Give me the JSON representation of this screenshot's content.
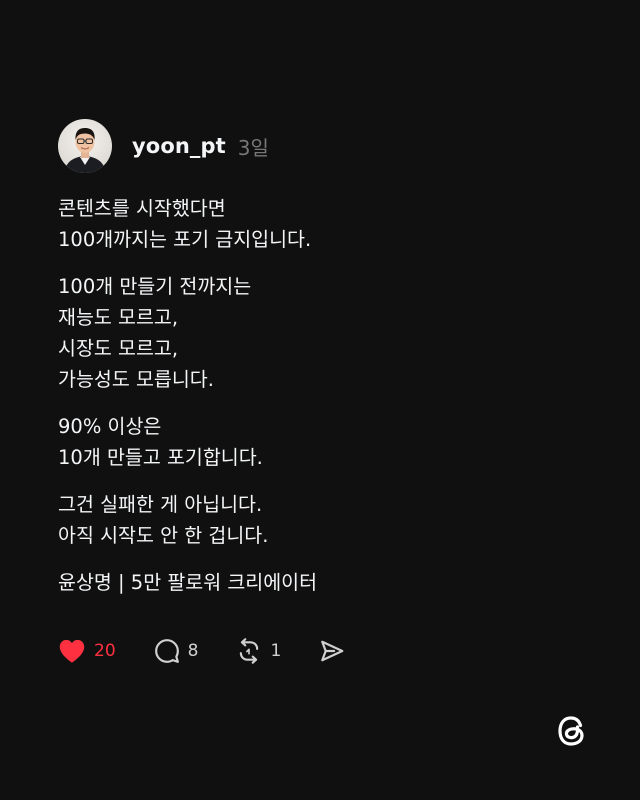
{
  "post": {
    "username": "yoon_pt",
    "time": "3일",
    "paragraphs": [
      [
        "콘텐츠를 시작했다면",
        "100개까지는 포기 금지입니다."
      ],
      [
        "100개 만들기 전까지는",
        "재능도 모르고,",
        "시장도 모르고,",
        "가능성도 모릅니다."
      ],
      [
        "90% 이상은",
        "10개 만들고 포기합니다."
      ],
      [
        "그건 실패한 게 아닙니다.",
        "아직 시작도 안 한 겁니다."
      ]
    ],
    "signature": "윤상명 | 5만 팔로워 크리에이터"
  },
  "actions": {
    "likes": "20",
    "replies": "8",
    "reposts": "1"
  },
  "icons": {
    "like": "heart-icon",
    "reply": "speech-bubble-icon",
    "repost": "repost-icon",
    "share": "send-icon",
    "logo": "threads-logo-icon"
  },
  "colors": {
    "background": "#101010",
    "text": "#f3f5f7",
    "muted": "#777777",
    "like": "#ff3040"
  }
}
